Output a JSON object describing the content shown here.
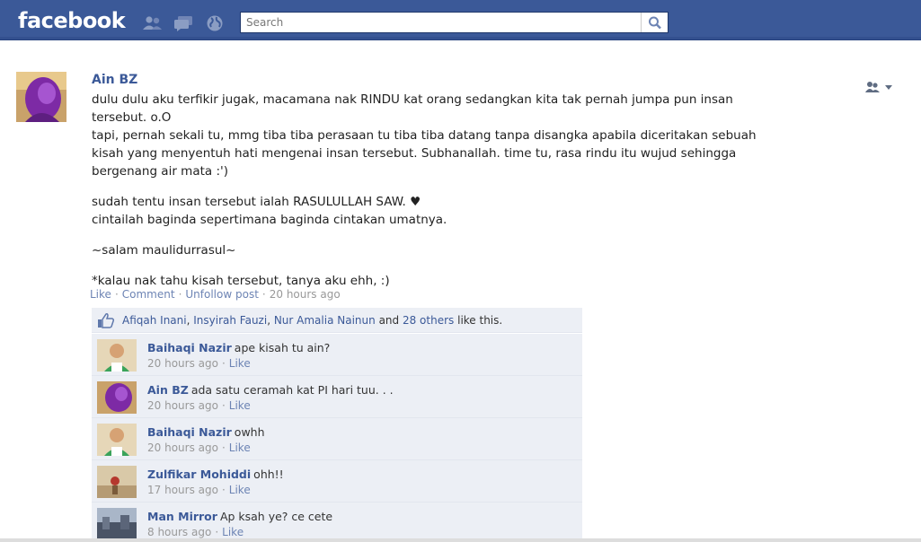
{
  "header": {
    "logo": "facebook",
    "search_placeholder": "Search",
    "jewels": [
      "friend-requests-icon",
      "messages-icon",
      "notifications-globe-icon"
    ],
    "brand_color": "#3b5998"
  },
  "post": {
    "author": "Ain BZ",
    "paragraphs": [
      "dulu dulu aku terfikir jugak, macamana nak RINDU kat orang sedangkan kita tak pernah jumpa pun insan\ntersebut. o.O\ntapi, pernah sekali tu, mmg tiba tiba perasaan tu tiba tiba datang tanpa disangka apabila diceritakan sebuah\nkisah yang menyentuh hati mengenai insan tersebut. Subhanallah. time tu, rasa rindu itu wujud sehingga\nbergenang air mata :')",
      "sudah tentu insan tersebut ialah RASULULLAH SAW. ♥\ncintailah baginda sepertimana baginda cintakan umatnya.",
      "~salam maulidurrasul~",
      "*kalau nak tahu kisah tersebut, tanya aku ehh, :)"
    ],
    "actions": {
      "like": "Like",
      "comment": "Comment",
      "unfollow": "Unfollow post",
      "time": "20 hours ago"
    },
    "likes": {
      "names": [
        "Afiqah Inani",
        "Insyirah Fauzi",
        "Nur Amalia Nainun"
      ],
      "and": "and",
      "others": "28 others",
      "suffix": "like this."
    }
  },
  "comments": [
    {
      "name": "Baihaqi Nazir",
      "text": "ape kisah tu ain?",
      "time": "20 hours ago",
      "like": "Like"
    },
    {
      "name": "Ain BZ",
      "text": "ada satu ceramah kat PI hari tuu. . .",
      "time": "20 hours ago",
      "like": "Like"
    },
    {
      "name": "Baihaqi Nazir",
      "text": "owhh",
      "time": "20 hours ago",
      "like": "Like"
    },
    {
      "name": "Zulfikar Mohiddi",
      "text": "ohh!!",
      "time": "17 hours ago",
      "like": "Like"
    },
    {
      "name": "Man Mirror",
      "text": "Ap ksah ye? ce cete",
      "time": "8 hours ago",
      "like": "Like"
    }
  ]
}
